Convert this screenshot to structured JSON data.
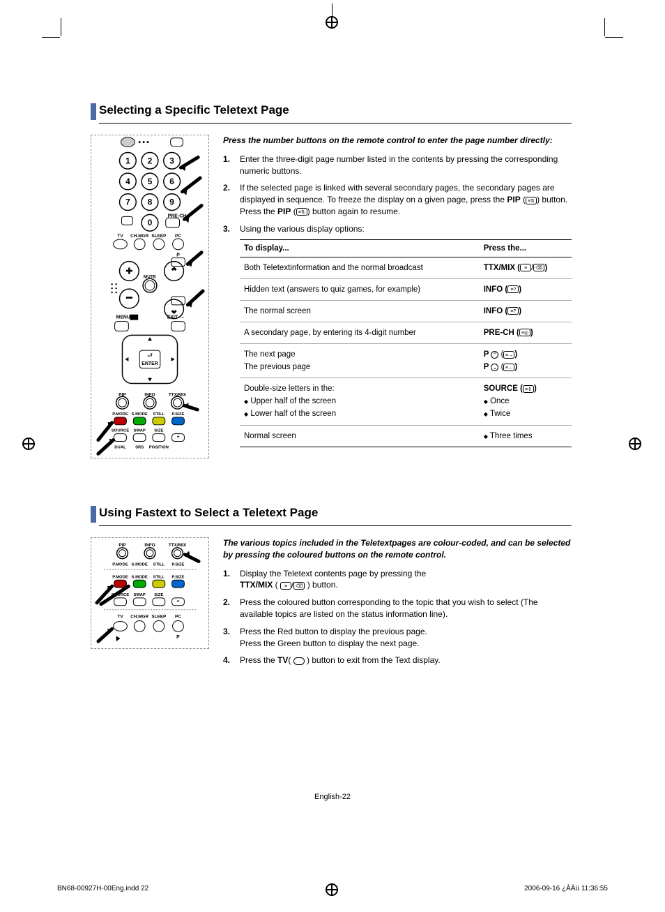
{
  "section1": {
    "heading": "Selecting a Specific Teletext Page",
    "intro": "Press the number buttons on the remote control to enter the page number directly:",
    "steps": [
      {
        "num": "1.",
        "text": "Enter the three-digit page number listed in the contents by pressing the corresponding numeric buttons."
      },
      {
        "num": "2.",
        "text_a": "If the selected page is linked with several secondary pages, the secondary pages are displayed in sequence. To freeze the display on a given page, press the ",
        "bold1": "PIP",
        "text_b": " (",
        "icon1": "≡⇅",
        "text_c": ") button. Press the ",
        "bold2": "PIP",
        "text_d": " (",
        "icon2": "≡⇅",
        "text_e": ") button again to resume."
      },
      {
        "num": "3.",
        "text": "Using the various display options:"
      }
    ],
    "table": {
      "header_left": "To display...",
      "header_right": "Press the...",
      "rows": [
        {
          "left": "Both Teletextinformation and the normal broadcast",
          "right": {
            "bold": "TTX/MIX (",
            "icon1": "≡",
            "sep": "/",
            "icon2": "⌫",
            "end": ")"
          }
        },
        {
          "left": "Hidden text (answers to quiz games, for example)",
          "right": {
            "bold": "INFO (",
            "icon1": "≡?",
            "end": ")"
          }
        },
        {
          "left": "The normal screen",
          "right": {
            "bold": "INFO (",
            "icon1": "≡?",
            "end": ")"
          }
        },
        {
          "left": "A secondary page, by entering its 4-digit number",
          "right": {
            "bold": "PRE-CH (",
            "icon1": "≡◎",
            "end": ")"
          }
        },
        {
          "left_multi": [
            "The next page",
            "The previous page"
          ],
          "right_multi": [
            {
              "bold": "P ",
              "circ": "⌃",
              "text": " (",
              "icon1": "≡→",
              "end": ")"
            },
            {
              "bold": "P ",
              "circ": "⌄",
              "text": " (",
              "icon1": "≡←",
              "end": ")"
            }
          ]
        },
        {
          "left_multi": [
            "Double-size letters in the:",
            "◆ Upper half of the screen",
            "◆ Lower half of the screen"
          ],
          "right_multi": [
            {
              "bold": "SOURCE (",
              "icon1": "≡⇕",
              "end": ")"
            },
            {
              "diamond": true,
              "text": "Once"
            },
            {
              "diamond": true,
              "text": "Twice"
            }
          ]
        },
        {
          "left": "Normal screen",
          "right_multi": [
            {
              "diamond": true,
              "text": "Three times"
            }
          ]
        }
      ]
    }
  },
  "section2": {
    "heading": "Using Fastext to Select a Teletext Page",
    "intro": "The various topics included in the Teletextpages are colour-coded, and can be selected by pressing the coloured buttons on the remote control.",
    "steps": [
      {
        "num": "1.",
        "text_a": "Display the Teletext contents page by pressing the ",
        "bold1": "TTX/MIX",
        "text_b": " ( ",
        "icon1": "≡",
        "sep": "/",
        "icon2": "⌫",
        "text_c": " ) button."
      },
      {
        "num": "2.",
        "text": "Press the coloured button corresponding to the topic that you wish to select (The available topics are listed on the status information line)."
      },
      {
        "num": "3.",
        "text_a": "Press the Red button to display the previous page.",
        "text_b": "Press the Green button to display the next page."
      },
      {
        "num": "4.",
        "text_a": "Press the ",
        "bold1": "TV",
        "text_b": "( ",
        "icon_shape": "round-rect",
        "text_c": " ) button to exit from the Text display."
      }
    ]
  },
  "page_number": "English-22",
  "footer_left": "BN68-00927H-00Eng.indd   22",
  "footer_right": "2006-09-16   ¿ÀÀü 11:36:55",
  "remote": {
    "numbers": [
      "1",
      "2",
      "3",
      "4",
      "5",
      "6",
      "7",
      "8",
      "9",
      "0"
    ],
    "labels_row": [
      "TV",
      "CH.MGR",
      "SLEEP",
      "PC"
    ],
    "p_label": "P",
    "mute_label": "MUTE",
    "pre_ch_label": "PRE-CH",
    "menu_label": "MENU",
    "exit_label": "EXIT",
    "enter_label": "ENTER",
    "row_pip": [
      "PIP",
      "INFO",
      "TTX/MIX"
    ],
    "row_pmode": [
      "P.MODE",
      "S.MODE",
      "STILL",
      "P.SIZE"
    ],
    "row_source": [
      "SOURCE",
      "SWAP",
      "SIZE",
      ""
    ],
    "row_dual": [
      "DUAL",
      "SRS",
      "POSITION",
      ""
    ],
    "chup": "⌃",
    "chdn": "⌄",
    "plus": "+",
    "minus": "−"
  }
}
